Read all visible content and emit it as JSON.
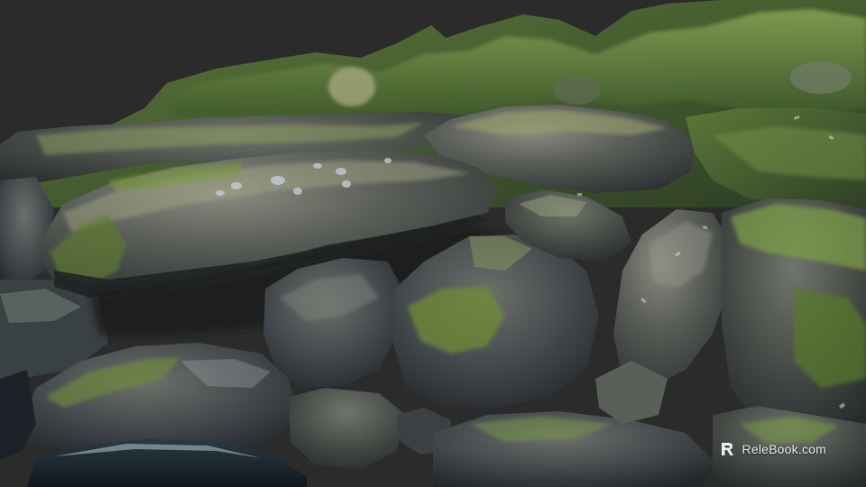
{
  "image": {
    "subject": "photogrammetry-scan-mossy-rock-outcrop",
    "background_color": "#2b2b2b",
    "palette": {
      "rock_dark": "#2f3334",
      "rock_mid": "#4e5452",
      "rock_light": "#7a7d74",
      "moss_dark": "#3f5a2c",
      "moss_bright": "#7f9e4a",
      "water": "#1c2a33"
    }
  },
  "watermark": {
    "text": "ReleBook.com",
    "icon": "relebook-logo-icon"
  }
}
